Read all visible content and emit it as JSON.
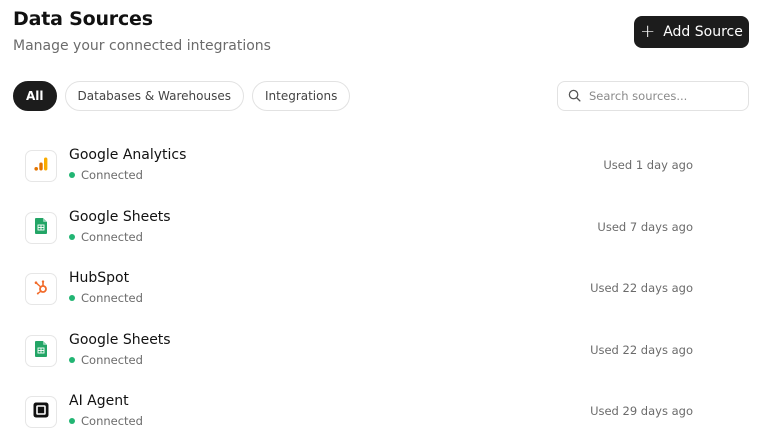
{
  "header": {
    "title": "Data Sources",
    "subtitle": "Manage your connected integrations",
    "add_button_label": "Add Source"
  },
  "filters": {
    "tabs": [
      {
        "label": "All",
        "active": true
      },
      {
        "label": "Databases & Warehouses",
        "active": false
      },
      {
        "label": "Integrations",
        "active": false
      }
    ]
  },
  "search": {
    "placeholder": "Search sources...",
    "value": ""
  },
  "colors": {
    "primary": "#1c1c1c",
    "connected": "#22b573"
  },
  "sources": [
    {
      "name": "Google Analytics",
      "status": "Connected",
      "last_used": "Used 1 day ago",
      "icon": "google-analytics-icon"
    },
    {
      "name": "Google Sheets",
      "status": "Connected",
      "last_used": "Used 7 days ago",
      "icon": "google-sheets-icon"
    },
    {
      "name": "HubSpot",
      "status": "Connected",
      "last_used": "Used 22 days ago",
      "icon": "hubspot-icon"
    },
    {
      "name": "Google Sheets",
      "status": "Connected",
      "last_used": "Used 22 days ago",
      "icon": "google-sheets-icon"
    },
    {
      "name": "AI Agent",
      "status": "Connected",
      "last_used": "Used 29 days ago",
      "icon": "ai-agent-icon"
    }
  ]
}
